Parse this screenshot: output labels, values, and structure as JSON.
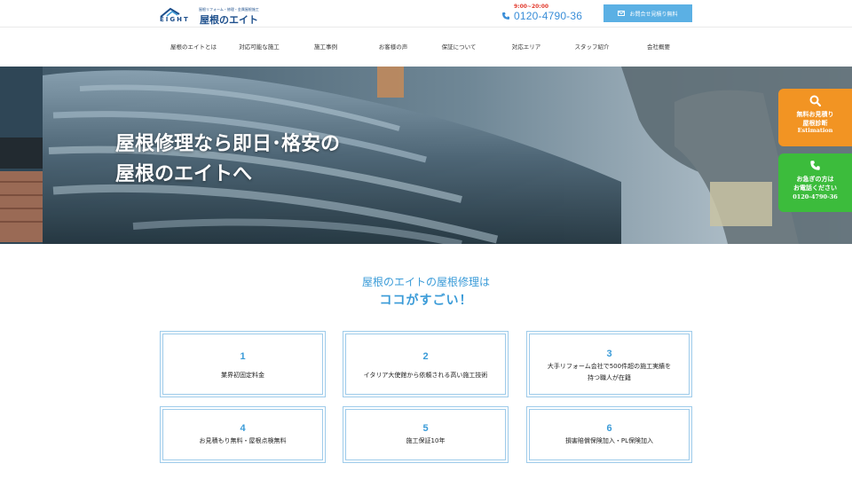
{
  "header": {
    "logo_tagline": "屋根リフォーム・修理・金属屋根施工",
    "logo_eight": "EIGHT",
    "logo_name": "屋根のエイト",
    "hours": "9:00~20:00",
    "phone": "0120-4790-36",
    "contact_button": "お問合せ見積り無料"
  },
  "nav": {
    "items": [
      "屋根のエイトとは",
      "対応可能な施工",
      "施工事例",
      "お客様の声",
      "保証について",
      "対応エリア",
      "スタッフ紹介",
      "会社概要"
    ]
  },
  "hero": {
    "line1": "屋根修理なら即日･格安の",
    "line2": "屋根のエイトへ"
  },
  "side": {
    "estimate": [
      "無料お見積り",
      "屋根診断",
      "Estimation"
    ],
    "call": [
      "お急ぎの方は",
      "お電話ください",
      "0120-4790-36"
    ]
  },
  "section": {
    "title1": "屋根のエイトの屋根修理は",
    "title2": "ココがすごい！"
  },
  "features": [
    {
      "num": "1",
      "text": "業界初固定料金"
    },
    {
      "num": "2",
      "text": "イタリア大使館から依頼される高い施工技術"
    },
    {
      "num": "3",
      "text": "大手リフォーム会社で500件超の施工実績を持つ職人が在籍",
      "line1": "大手リフォーム会社で500件超の施工実績を",
      "line2": "持つ職人が在籍"
    },
    {
      "num": "4",
      "text": "お見積もり無料・屋根点検無料"
    },
    {
      "num": "5",
      "text": "施工保証10年"
    },
    {
      "num": "6",
      "text": "損害賠償保険加入・PL保険加入"
    }
  ],
  "colors": {
    "accent_blue": "#3a9bd8",
    "button_blue": "#5bb0e4",
    "orange": "#f29423",
    "green": "#3cbc3c",
    "hours_red": "#e23b2e"
  }
}
